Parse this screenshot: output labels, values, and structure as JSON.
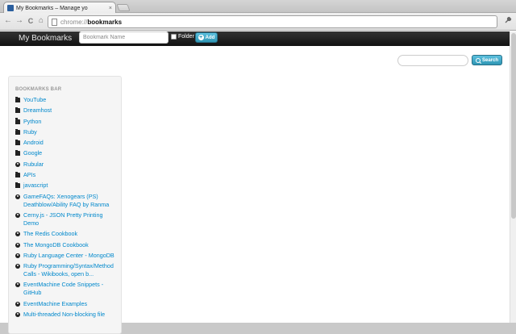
{
  "browser": {
    "tab_title": "My Bookmarks – Manage yo",
    "tab_close": "×",
    "url_scheme": "chrome://",
    "url_host": "bookmarks",
    "back": "←",
    "forward": "→",
    "reload": "C",
    "home": "⌂",
    "menu": "🔧"
  },
  "navbar": {
    "brand": "My Bookmarks",
    "name_placeholder": "Bookmark Name",
    "folder_label": "Folder",
    "add_label": "Add"
  },
  "search": {
    "button_label": "Search"
  },
  "sidebar": {
    "header": "BOOKMARKS BAR",
    "items": [
      {
        "label": "YouTube",
        "icon": "folder-icon"
      },
      {
        "label": "Dreamhost",
        "icon": "folder-icon"
      },
      {
        "label": "Python",
        "icon": "folder-icon"
      },
      {
        "label": "Ruby",
        "icon": "folder-icon"
      },
      {
        "label": "Android",
        "icon": "folder-icon"
      },
      {
        "label": "Google",
        "icon": "folder-icon"
      },
      {
        "label": "Rubular",
        "icon": "globe-icon"
      },
      {
        "label": "APIs",
        "icon": "folder-icon"
      },
      {
        "label": "javascript",
        "icon": "folder-icon"
      },
      {
        "label": "GameFAQs: Xenogears (PS) Deathblow/Ability FAQ by Ranma",
        "icon": "globe-icon"
      },
      {
        "label": "Cerny.js - JSON Pretty Printing Demo",
        "icon": "globe-icon"
      },
      {
        "label": "The Redis Cookbook",
        "icon": "globe-icon"
      },
      {
        "label": "The MongoDB Cookbook",
        "icon": "globe-icon"
      },
      {
        "label": "Ruby Language Center - MongoDB",
        "icon": "globe-icon"
      },
      {
        "label": "Ruby Programming/Syntax/Method Calls - Wikibooks, open b...",
        "icon": "globe-icon"
      },
      {
        "label": "EventMachine Code Snippets - GitHub",
        "icon": "globe-icon"
      },
      {
        "label": "EventMachine Examples",
        "icon": "globe-icon"
      },
      {
        "label": "Multi-threaded Non-blocking file",
        "icon": "globe-icon"
      }
    ]
  },
  "colors": {
    "link": "#0088cc",
    "accent": "#2f96b4",
    "navbar": "#1b1b1b"
  }
}
